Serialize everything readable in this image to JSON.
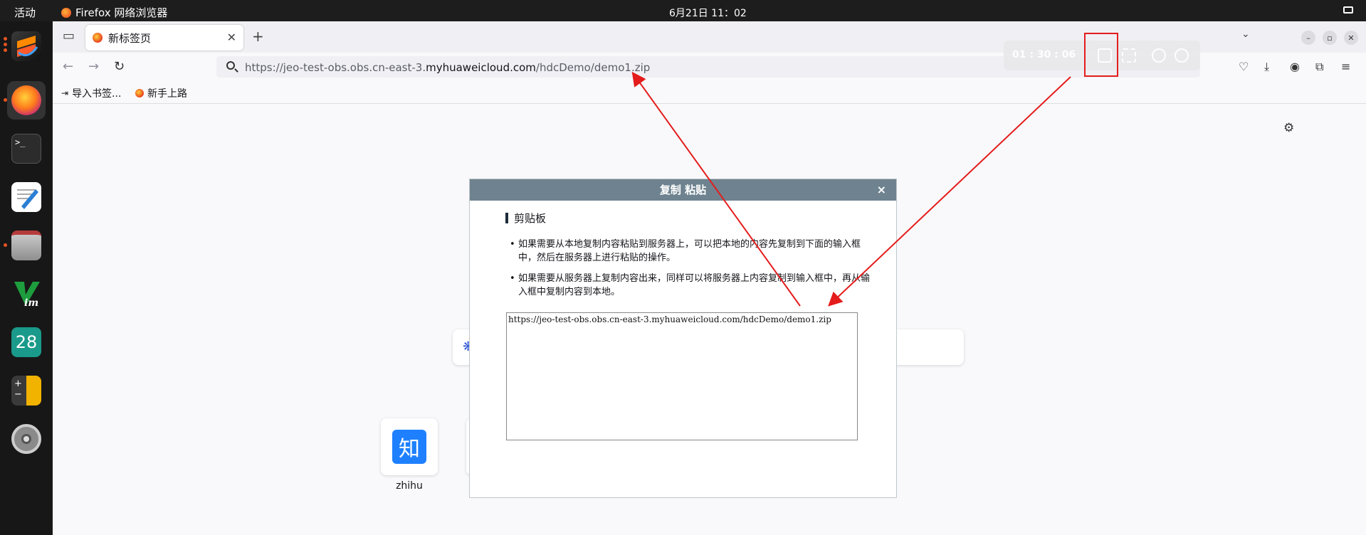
{
  "system": {
    "activities": "活动",
    "app_name": "Firefox 网络浏览器",
    "clock": "6月21日  11：02"
  },
  "dock": {
    "items": [
      "sublime-text",
      "firefox",
      "terminal",
      "text-editor",
      "files",
      "vim",
      "calendar",
      "calculator",
      "settings"
    ],
    "calendar_day": "28"
  },
  "browser": {
    "tab_title": "新标签页",
    "url_prefix": "https://jeo-test-obs.obs.cn-east-3.",
    "url_host": "myhuaweicloud.com",
    "url_path": "/hdcDemo/demo1.zip",
    "bookmarks": [
      "导入书签...",
      "新手上路"
    ]
  },
  "remote_toolbar": {
    "timer": "01 : 30 : 06"
  },
  "newtab": {
    "topsite_label": "zhihu",
    "topsite_icon_text": "知"
  },
  "dialog": {
    "title": "复制 粘贴",
    "close": "×",
    "section_title": "剪贴板",
    "bullets": [
      "如果需要从本地复制内容粘贴到服务器上，可以把本地的内容先复制到下面的输入框中，然后在服务器上进行粘贴的操作。",
      "如果需要从服务器上复制内容出来，同样可以将服务器上内容复制到输入框中，再从输入框中复制内容到本地。"
    ],
    "clipboard_value": "https://jeo-test-obs.obs.cn-east-3.myhuaweicloud.com/hdcDemo/demo1.zip"
  },
  "colors": {
    "annotation": "#e41c1c",
    "dialog_header": "#6e838f"
  }
}
